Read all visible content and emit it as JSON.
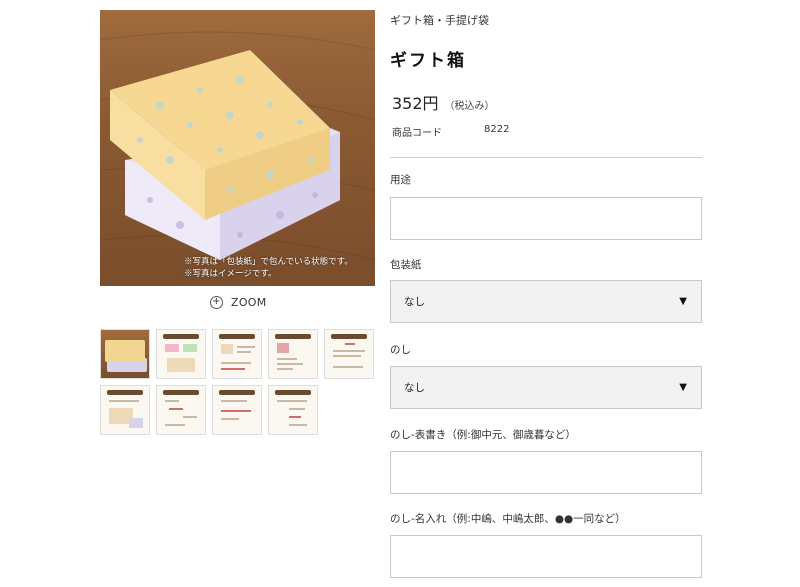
{
  "breadcrumb": "ギフト箱・手提げ袋",
  "product": {
    "title": "ギフト箱",
    "price": "352円",
    "tax_note": "（税込み）",
    "code_label": "商品コード",
    "code_value": "8222"
  },
  "gallery": {
    "caption_line1": "※写真は「包装紙」で包んでいる状態です。",
    "caption_line2": "※写真はイメージです。",
    "zoom_label": "ZOOM",
    "thumbnail_count": 9
  },
  "fields": {
    "usage_label": "用途",
    "usage_value": "",
    "wrapping_label": "包装紙",
    "wrapping_selected": "なし",
    "noshi_label": "のし",
    "noshi_selected": "なし",
    "omotegaki_label": "のし-表書き（例:御中元、御歳暮など）",
    "omotegaki_value": "",
    "nairei_label": "のし-名入れ（例:中嶋、中嶋太郎、●●一同など）",
    "nairei_value": ""
  },
  "colors": {
    "select_bg": "#f2f2f2",
    "border": "#c8c8c8",
    "text": "#222222"
  }
}
